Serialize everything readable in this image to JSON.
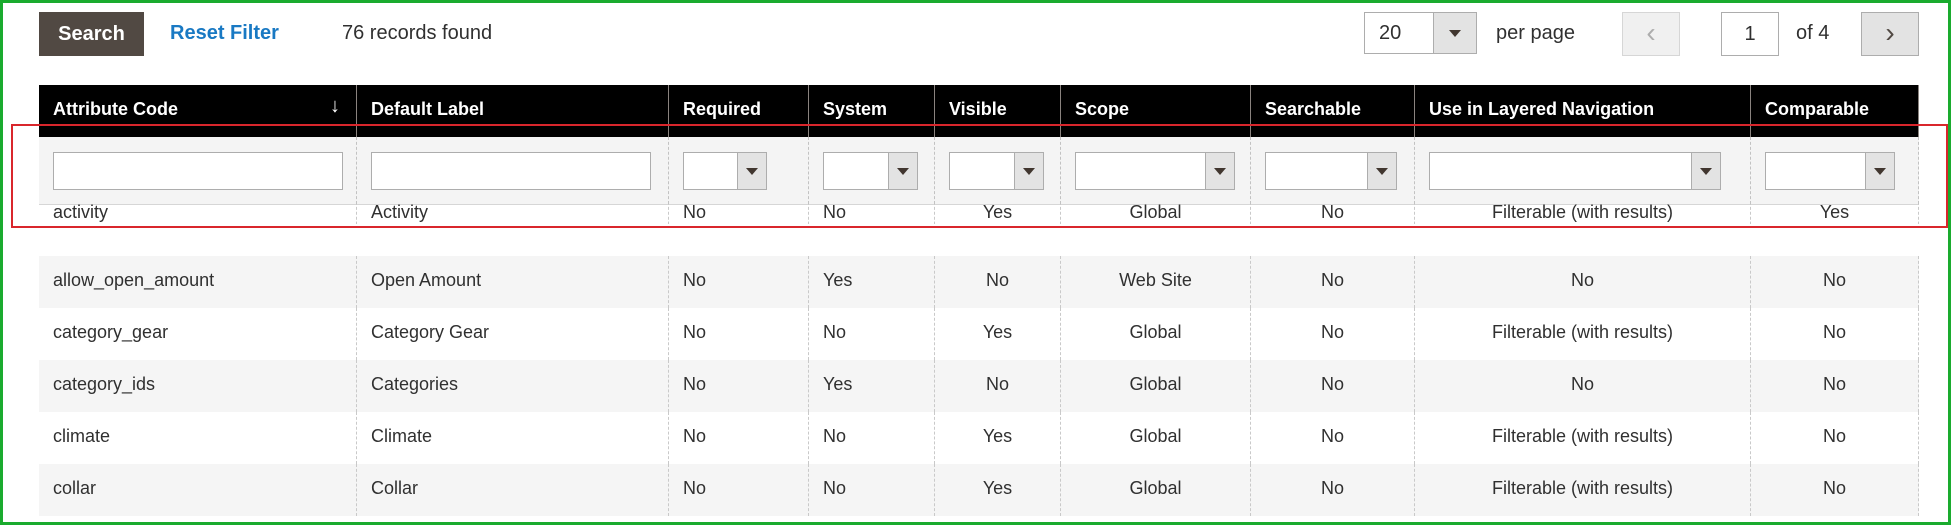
{
  "toolbar": {
    "search_label": "Search",
    "reset_label": "Reset Filter",
    "records_text": "76 records found",
    "per_page_value": "20",
    "per_page_label": "per page",
    "prev_icon": "‹",
    "next_icon": "›",
    "current_page": "1",
    "of_pages": "of 4"
  },
  "columns": [
    {
      "label": "Attribute Code",
      "filter": "text"
    },
    {
      "label": "Default Label",
      "filter": "text"
    },
    {
      "label": "Required",
      "filter": "select"
    },
    {
      "label": "System",
      "filter": "select"
    },
    {
      "label": "Visible",
      "filter": "select"
    },
    {
      "label": "Scope",
      "filter": "select"
    },
    {
      "label": "Searchable",
      "filter": "select"
    },
    {
      "label": "Use in Layered Navigation",
      "filter": "select"
    },
    {
      "label": "Comparable",
      "filter": "select"
    }
  ],
  "sort_icon": "↓",
  "rows": [
    [
      "activity",
      "Activity",
      "No",
      "No",
      "Yes",
      "Global",
      "No",
      "Filterable (with results)",
      "Yes"
    ],
    [
      "allow_open_amount",
      "Open Amount",
      "No",
      "Yes",
      "No",
      "Web Site",
      "No",
      "No",
      "No"
    ],
    [
      "category_gear",
      "Category Gear",
      "No",
      "No",
      "Yes",
      "Global",
      "No",
      "Filterable (with results)",
      "No"
    ],
    [
      "category_ids",
      "Categories",
      "No",
      "Yes",
      "No",
      "Global",
      "No",
      "No",
      "No"
    ],
    [
      "climate",
      "Climate",
      "No",
      "No",
      "Yes",
      "Global",
      "No",
      "Filterable (with results)",
      "No"
    ],
    [
      "collar",
      "Collar",
      "No",
      "No",
      "Yes",
      "Global",
      "No",
      "Filterable (with results)",
      "No"
    ]
  ],
  "colors": {
    "highlight_green": "#1aab2e",
    "highlight_red": "#d9262c",
    "link_blue": "#1979c3",
    "search_button": "#514943"
  }
}
